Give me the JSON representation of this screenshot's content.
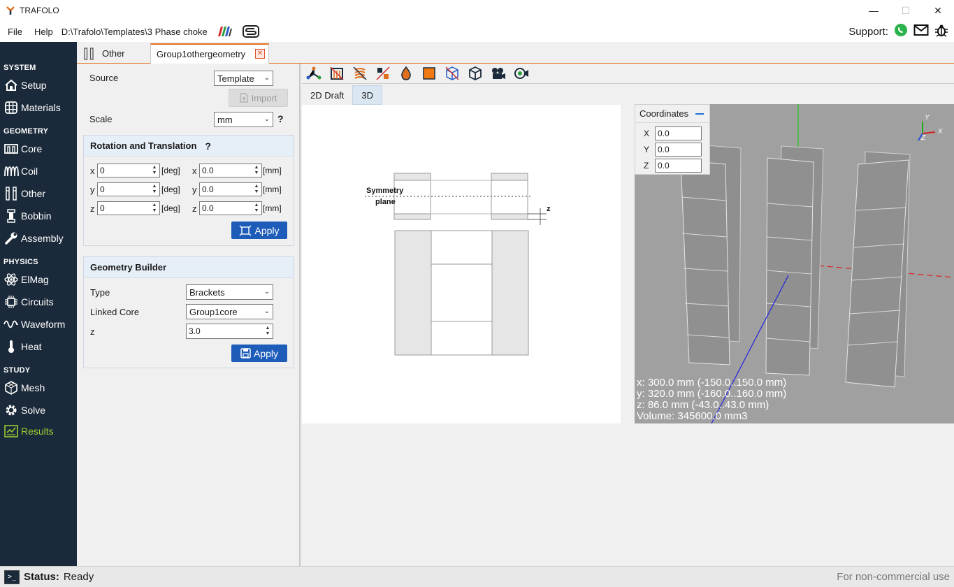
{
  "window": {
    "title": "TRAFOLO"
  },
  "menu": {
    "file": "File",
    "help": "Help",
    "path": "D:\\Trafolo\\Templates\\3 Phase choke"
  },
  "support": {
    "label": "Support:"
  },
  "sidebar": {
    "sections": [
      "SYSTEM",
      "GEOMETRY",
      "PHYSICS",
      "STUDY"
    ],
    "items": [
      {
        "label": "Setup",
        "icon": "home-icon"
      },
      {
        "label": "Materials",
        "icon": "grid-icon"
      },
      {
        "label": "Core",
        "icon": "core-icon"
      },
      {
        "label": "Coil",
        "icon": "coil-icon"
      },
      {
        "label": "Other",
        "icon": "other-geometry-icon"
      },
      {
        "label": "Bobbin",
        "icon": "bobbin-icon"
      },
      {
        "label": "Assembly",
        "icon": "wrench-icon"
      },
      {
        "label": "ElMag",
        "icon": "atom-icon"
      },
      {
        "label": "Circuits",
        "icon": "circuit-icon"
      },
      {
        "label": "Waveform",
        "icon": "wave-icon"
      },
      {
        "label": "Heat",
        "icon": "thermometer-icon"
      },
      {
        "label": "Mesh",
        "icon": "mesh-icon"
      },
      {
        "label": "Solve",
        "icon": "gear-icon"
      },
      {
        "label": "Results",
        "icon": "results-icon"
      }
    ],
    "active_color": "#9acd32"
  },
  "tabs": {
    "other": "Other",
    "active": "Group1othergeometry"
  },
  "panel": {
    "source_label": "Source",
    "source_value": "Template",
    "import_label": "Import",
    "scale_label": "Scale",
    "scale_value": "mm",
    "help": "?",
    "rt": {
      "title": "Rotation and Translation",
      "rows": [
        {
          "axis": "x",
          "rot": "0",
          "rot_unit": "[deg]",
          "axis2": "x",
          "trans": "0.0",
          "trans_unit": "[mm]"
        },
        {
          "axis": "y",
          "rot": "0",
          "rot_unit": "[deg]",
          "axis2": "y",
          "trans": "0.0",
          "trans_unit": "[mm]"
        },
        {
          "axis": "z",
          "rot": "0",
          "rot_unit": "[deg]",
          "axis2": "z",
          "trans": "0.0",
          "trans_unit": "[mm]"
        }
      ],
      "apply": "Apply"
    },
    "gb": {
      "title": "Geometry Builder",
      "type_label": "Type",
      "type_value": "Brackets",
      "core_label": "Linked Core",
      "core_value": "Group1core",
      "z_label": "z",
      "z_value": "3.0",
      "apply": "Apply"
    }
  },
  "view": {
    "subtabs": [
      "2D Draft",
      "3D"
    ],
    "draft_labels": {
      "sym1": "Symmetry",
      "sym2": "plane",
      "z": "z"
    },
    "coords": {
      "title": "Coordinates",
      "x_label": "X",
      "x_value": "0.0",
      "y_label": "Y",
      "y_value": "0.0",
      "z_label": "Z",
      "z_value": "0.0"
    },
    "axis_labels": {
      "x": "X",
      "y": "Y",
      "z": "Z"
    },
    "info": [
      "x: 300.0 mm (-150.0..150.0 mm)",
      "y: 320.0 mm (-160.0..160.0 mm)",
      "z: 86.0 mm (-43.0..43.0 mm)",
      "Volume: 345600.0 mm3"
    ]
  },
  "status": {
    "label": "Status:",
    "value": "Ready",
    "license": "For non-commercial use"
  },
  "colors": {
    "accent": "#e07020",
    "sidebar_bg": "#1b2a3a",
    "button_blue": "#1d5cb8"
  }
}
